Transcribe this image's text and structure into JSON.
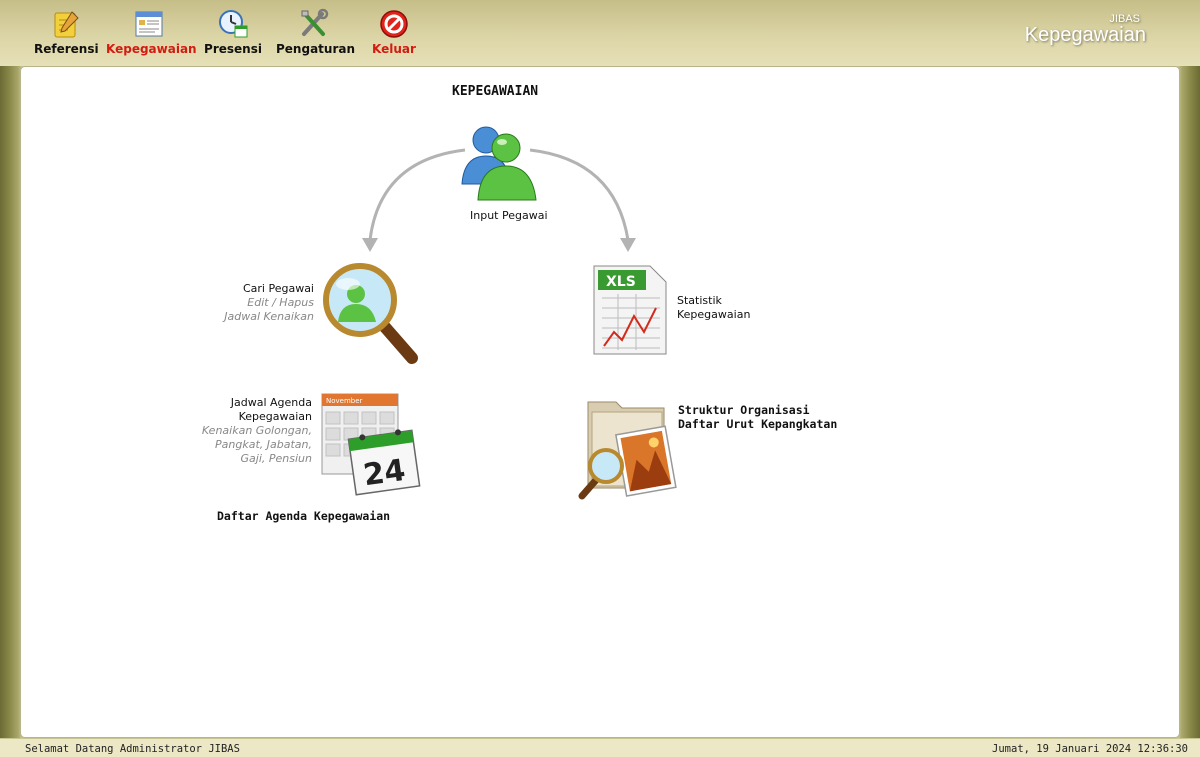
{
  "nav": {
    "items": [
      {
        "label": "Referensi"
      },
      {
        "label": "Kepegawaian"
      },
      {
        "label": "Presensi"
      },
      {
        "label": "Pengaturan"
      },
      {
        "label": "Keluar"
      }
    ]
  },
  "brand": {
    "small": "JIBAS",
    "big": "Kepegawaian"
  },
  "main": {
    "title": "KEPEGAWAIAN",
    "input_pegawai": "Input Pegawai",
    "cari": {
      "title": "Cari Pegawai",
      "sub1": "Edit / Hapus",
      "sub2": "Jadwal Kenaikan"
    },
    "statistik": {
      "line1": "Statistik",
      "line2": "Kepegawaian"
    },
    "jadwal": {
      "line1": "Jadwal Agenda",
      "line2": "Kepegawaian",
      "sub1": "Kenaikan Golongan,",
      "sub2": "Pangkat, Jabatan,",
      "sub3": "Gaji, Pensiun",
      "calendar_month": "November",
      "calendar_day": "24"
    },
    "daftar_agenda": "Daftar Agenda Kepegawaian",
    "struktur": {
      "line1": "Struktur Organisasi",
      "line2": "Daftar Urut Kepangkatan"
    },
    "xls_label": "XLS"
  },
  "footer": {
    "welcome": "Selamat Datang Administrator JIBAS",
    "datetime": "Jumat, 19 Januari 2024 12:36:30"
  },
  "colors": {
    "accent_red": "#d41b12",
    "topbar": "#ddd6a8",
    "green": "#2e9e2a"
  }
}
